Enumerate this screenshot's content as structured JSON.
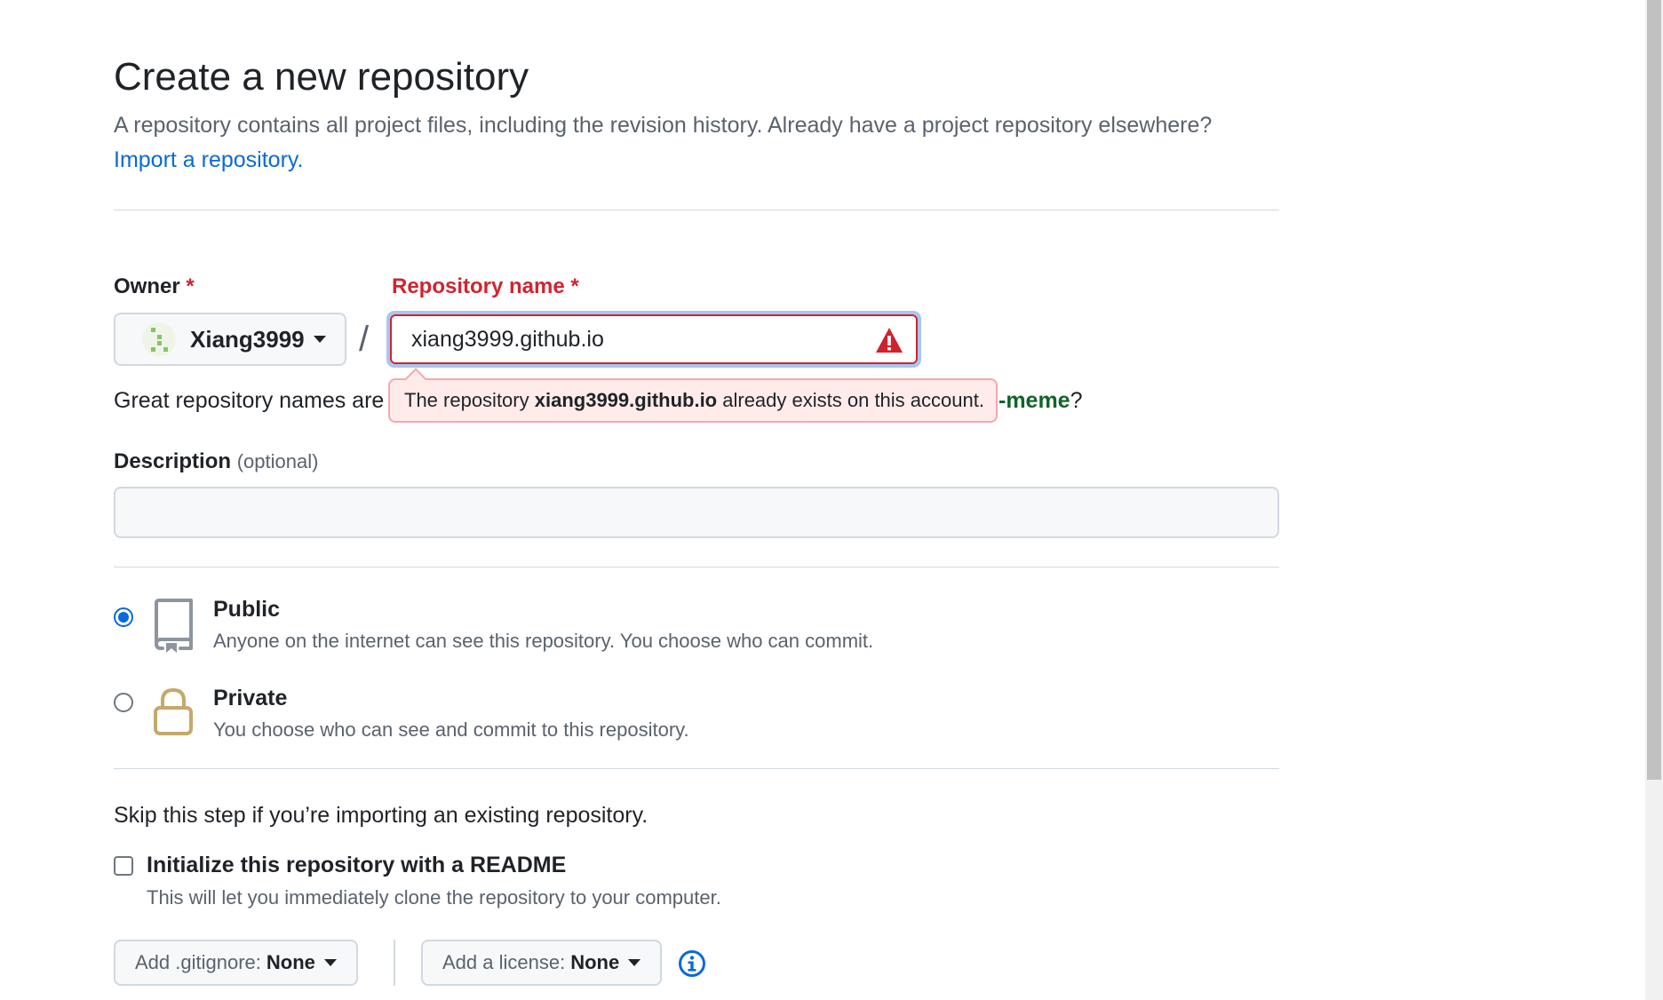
{
  "page": {
    "title": "Create a new repository",
    "subtitle": "A repository contains all project files, including the revision history. Already have a project repository elsewhere?",
    "import_link": "Import a repository."
  },
  "owner": {
    "label": "Owner",
    "required_mark": "*",
    "name": "Xiang3999"
  },
  "repo_name": {
    "label": "Repository name",
    "required_mark": "*",
    "value": "xiang3999.github.io",
    "hint_prefix": "Great repository names are",
    "hint_suffix_bold": "-meme",
    "hint_suffix_end": "?",
    "error": {
      "prefix": "The repository",
      "name": "xiang3999.github.io",
      "suffix": "already exists on this account."
    }
  },
  "description": {
    "label": "Description",
    "optional": "(optional)",
    "value": ""
  },
  "visibility": {
    "selected": "public",
    "public": {
      "title": "Public",
      "desc": "Anyone on the internet can see this repository. You choose who can commit."
    },
    "private": {
      "title": "Private",
      "desc": "You choose who can see and commit to this repository."
    }
  },
  "init": {
    "skip_text": "Skip this step if you’re importing an existing repository.",
    "readme_label": "Initialize this repository with a README",
    "readme_desc": "This will let you immediately clone the repository to your computer.",
    "readme_checked": false,
    "gitignore_label": "Add .gitignore:",
    "gitignore_value": "None",
    "license_label": "Add a license:",
    "license_value": "None"
  },
  "colors": {
    "accent": "#0969da",
    "danger": "#d1242f",
    "success_text": "#116329",
    "error_bg": "#ffebe9"
  }
}
